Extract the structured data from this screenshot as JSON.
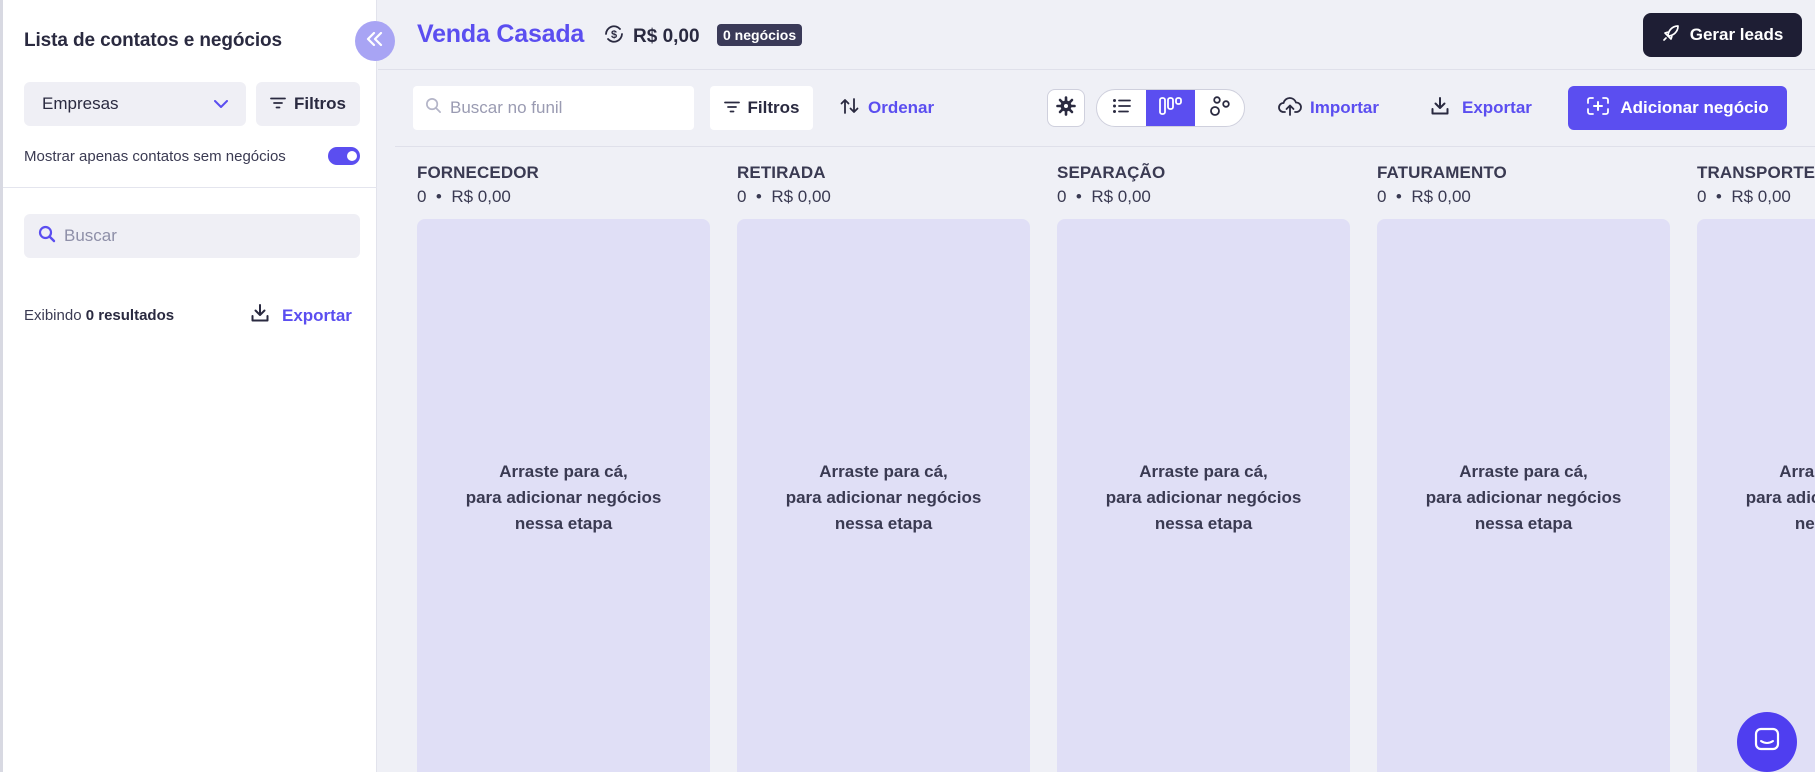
{
  "sidebar": {
    "title": "Lista de contatos e negócios",
    "select_value": "Empresas",
    "filter_label": "Filtros",
    "toggle_label": "Mostrar apenas contatos sem negócios",
    "toggle_on": true,
    "search_placeholder": "Buscar",
    "results_prefix": "Exibindo",
    "results_count": "0 resultados",
    "export_label": "Exportar"
  },
  "header": {
    "funnel_title": "Venda Casada",
    "total_value": "R$ 0,00",
    "deals_badge": "0 negócios",
    "generate_leads_label": "Gerar leads"
  },
  "toolbar": {
    "search_placeholder": "Buscar no funil",
    "filter_label": "Filtros",
    "order_label": "Ordenar",
    "import_label": "Importar",
    "export_label": "Exportar",
    "add_deal_label": "Adicionar negócio",
    "active_view": "kanban"
  },
  "columns": [
    {
      "name": "FORNECEDOR",
      "count": "0",
      "value": "R$ 0,00",
      "drop_line1": "Arraste para cá,",
      "drop_line2": "para adicionar negócios",
      "drop_line3": "nessa etapa"
    },
    {
      "name": "RETIRADA",
      "count": "0",
      "value": "R$ 0,00",
      "drop_line1": "Arraste para cá,",
      "drop_line2": "para adicionar negócios",
      "drop_line3": "nessa etapa"
    },
    {
      "name": "SEPARAÇÃO",
      "count": "0",
      "value": "R$ 0,00",
      "drop_line1": "Arraste para cá,",
      "drop_line2": "para adicionar negócios",
      "drop_line3": "nessa etapa"
    },
    {
      "name": "FATURAMENTO",
      "count": "0",
      "value": "R$ 0,00",
      "drop_line1": "Arraste para cá,",
      "drop_line2": "para adicionar negócios",
      "drop_line3": "nessa etapa"
    },
    {
      "name": "TRANSPORTES",
      "count": "0",
      "value": "R$ 0,00",
      "drop_line1": "Arraste para cá,",
      "drop_line2": "para adicionar negócios",
      "drop_line3": "nessa etapa"
    }
  ],
  "colors": {
    "accent": "#5b4ef0",
    "dark": "#1e1e34",
    "column_bg": "#e0dff6",
    "page_bg": "#eff0f6"
  }
}
